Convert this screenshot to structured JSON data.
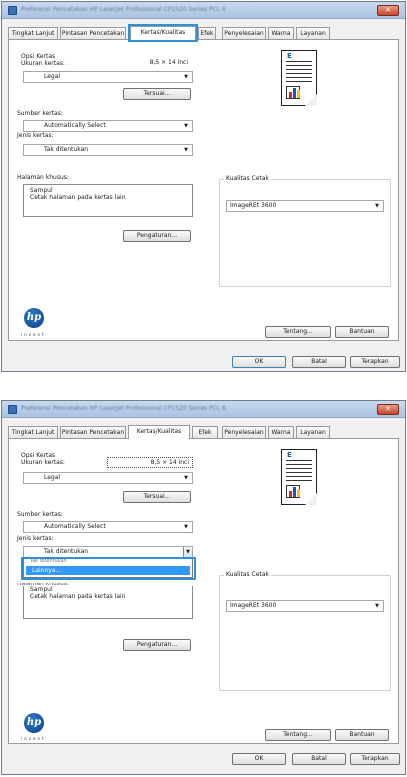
{
  "window": {
    "title": "Preferensi Pencetakan HP LaserJet Professional CP1520 Series PCL 6",
    "close": "✕"
  },
  "tabs": [
    "Tingkat Lanjut",
    "Pintasan Pencetakan",
    "Kertas/Kualitas",
    "Efek",
    "Penyelesaian",
    "Warna",
    "Layanan"
  ],
  "paper": {
    "opsi_kertas": "Opsi Kertas",
    "ukuran_label": "Ukuran kertas:",
    "ukuran_value": "8,5 × 14 inci",
    "ukuran_select": "Legal",
    "tersuai_button": "Tersuai...",
    "sumber_label": "Sumber kertas:",
    "sumber_value": "Automatically Select",
    "jenis_label": "Jenis kertas:",
    "jenis_value": "Tak ditentukan",
    "halaman_label": "Halaman khusus:",
    "halaman_items": [
      "Sampul",
      "Cetak halaman pada kertas lain"
    ],
    "pengaturan_button": "Pengaturan..."
  },
  "quality": {
    "group_label": "Kualitas Cetak",
    "value": "ImageREt 3600"
  },
  "dropdown": {
    "partial_item": "Tak ditentukan",
    "selected_item": "Lainnya..."
  },
  "footer": {
    "logo_text": "hp",
    "invent": "invent",
    "tentang_button": "Tentang...",
    "bantuan_button": "Bantuan",
    "ok_button": "OK",
    "batal_button": "Batal",
    "terapkan_button": "Terapkan"
  },
  "colors": {
    "highlight": "#2f8fd7",
    "selection": "#3399ff",
    "close": "#c7452a"
  }
}
